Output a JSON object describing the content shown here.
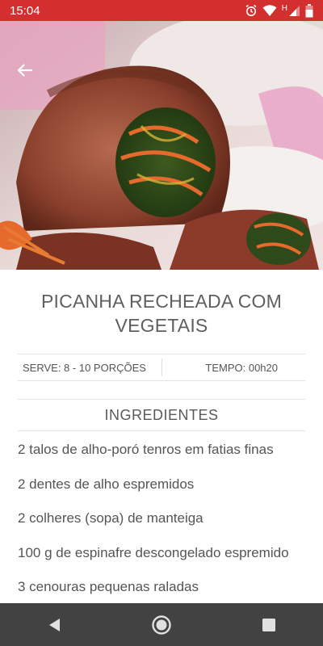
{
  "status_bar": {
    "time": "15:04",
    "network_label": "H",
    "icons": [
      "alarm-icon",
      "wifi-icon",
      "signal-icon",
      "battery-icon"
    ]
  },
  "colors": {
    "status_bar": "#d32f2f",
    "nav_bar": "#424242",
    "text": "#555555"
  },
  "recipe": {
    "title": "PICANHA RECHEADA COM VEGETAIS",
    "serves": "SERVE: 8 - 10 PORÇÕES",
    "time": "TEMPO: 00h20",
    "ingredients_header": "INGREDIENTES",
    "ingredients": [
      "2 talos de alho-poró tenros em fatias finas",
      "2 dentes de alho espremidos",
      "2 colheres (sopa) de manteiga",
      "100 g de espinafre descongelado espremido",
      "3 cenouras pequenas raladas"
    ]
  },
  "nav": {
    "buttons": [
      "back-nav-icon",
      "home-nav-icon",
      "recents-nav-icon"
    ]
  }
}
